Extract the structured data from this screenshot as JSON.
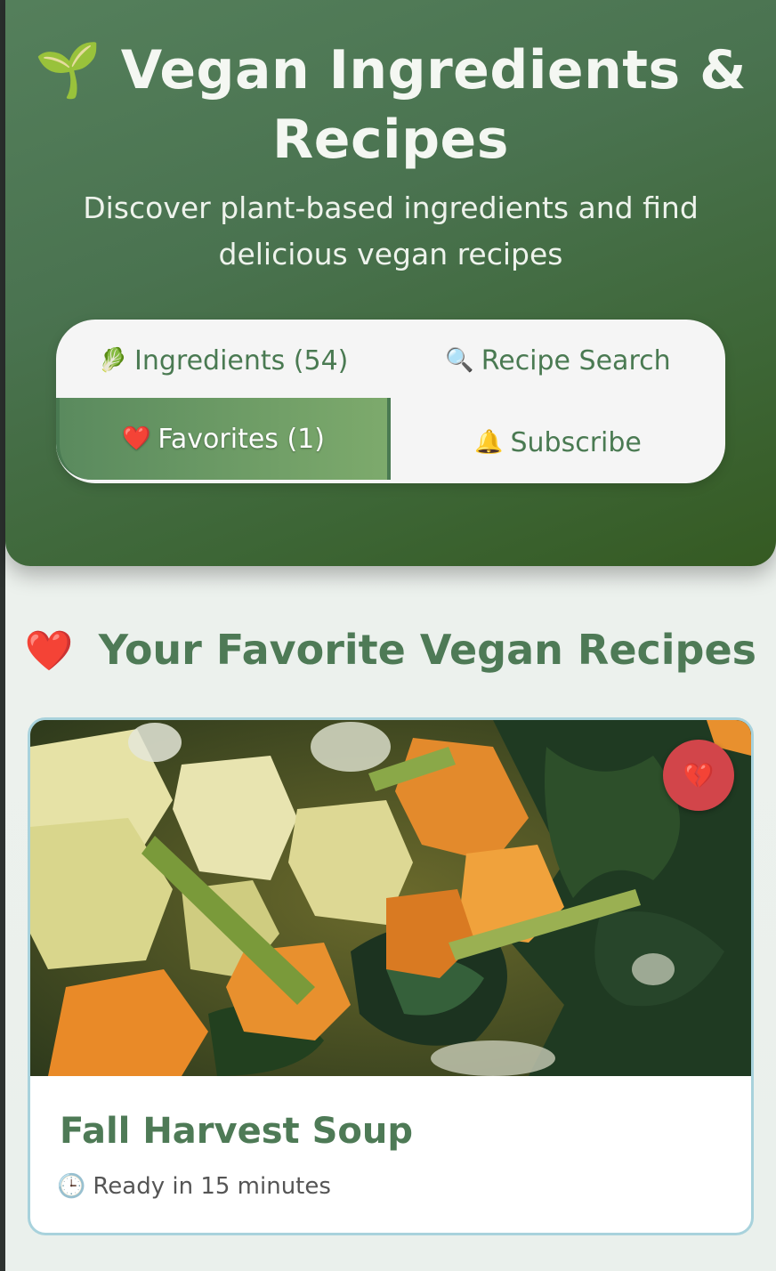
{
  "header": {
    "title_icon": "🌱",
    "title": "Vegan Ingredients & Recipes",
    "subtitle": "Discover plant-based ingredients and find delicious vegan recipes"
  },
  "tabs": [
    {
      "icon": "🥬",
      "label": "Ingredients (54)",
      "active": false
    },
    {
      "icon": "🔍",
      "label": "Recipe Search",
      "active": false
    },
    {
      "icon": "❤️",
      "label": "Favorites (1)",
      "active": true
    },
    {
      "icon": "🔔",
      "label": "Subscribe",
      "active": false
    }
  ],
  "favorites": {
    "icon": "❤️",
    "heading": "Your Favorite Vegan Recipes",
    "recipes": [
      {
        "title": "Fall Harvest Soup",
        "ready_icon": "🕒",
        "ready_text": "Ready in 15 minutes",
        "unfavorite_icon": "💔"
      }
    ]
  },
  "colors": {
    "header_green": "#4a7350",
    "accent_green": "#4e7a56",
    "active_tab": "#7daa6c",
    "unfavorite_red": "#d2454a",
    "card_border": "#a8d2dc"
  }
}
